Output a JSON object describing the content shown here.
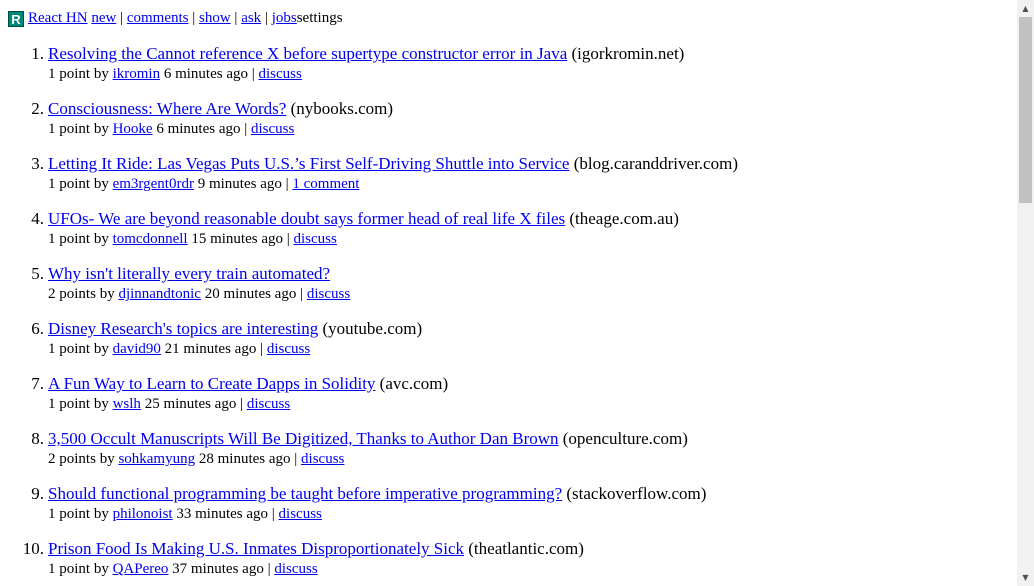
{
  "header": {
    "logo_letter": "R",
    "brand": "React HN",
    "nav": [
      {
        "label": "new"
      },
      {
        "label": "comments"
      },
      {
        "label": "show"
      },
      {
        "label": "ask"
      },
      {
        "label": "jobs"
      }
    ],
    "separator": "|",
    "settings_label": "settings",
    "logo_color": "#00897b"
  },
  "stories": [
    {
      "rank": "1.",
      "title": "Resolving the Cannot reference X before supertype constructor error in Java",
      "site": "(igorkromin.net)",
      "points": "1 point",
      "by": "by",
      "user": "ikromin",
      "age": "6 minutes ago",
      "discuss": "discuss"
    },
    {
      "rank": "2.",
      "title": "Consciousness: Where Are Words?",
      "site": "(nybooks.com)",
      "points": "1 point",
      "by": "by",
      "user": "Hooke",
      "age": "6 minutes ago",
      "discuss": "discuss"
    },
    {
      "rank": "3.",
      "title": "Letting It Ride: Las Vegas Puts U.S.’s First Self-Driving Shuttle into Service",
      "site": "(blog.caranddriver.com)",
      "points": "1 point",
      "by": "by",
      "user": "em3rgent0rdr",
      "age": "9 minutes ago",
      "discuss": "1 comment"
    },
    {
      "rank": "4.",
      "title": "UFOs- We are beyond reasonable doubt says former head of real life X files",
      "site": "(theage.com.au)",
      "points": "1 point",
      "by": "by",
      "user": "tomcdonnell",
      "age": "15 minutes ago",
      "discuss": "discuss"
    },
    {
      "rank": "5.",
      "title": "Why isn't literally every train automated?",
      "site": "",
      "points": "2 points",
      "by": "by",
      "user": "djinnandtonic",
      "age": "20 minutes ago",
      "discuss": "discuss"
    },
    {
      "rank": "6.",
      "title": "Disney Research's topics are interesting",
      "site": "(youtube.com)",
      "points": "1 point",
      "by": "by",
      "user": "david90",
      "age": "21 minutes ago",
      "discuss": "discuss"
    },
    {
      "rank": "7.",
      "title": "A Fun Way to Learn to Create Dapps in Solidity",
      "site": "(avc.com)",
      "points": "1 point",
      "by": "by",
      "user": "wslh",
      "age": "25 minutes ago",
      "discuss": "discuss"
    },
    {
      "rank": "8.",
      "title": "3,500 Occult Manuscripts Will Be Digitized, Thanks to Author Dan Brown",
      "site": "(openculture.com)",
      "points": "2 points",
      "by": "by",
      "user": "sohkamyung",
      "age": "28 minutes ago",
      "discuss": "discuss"
    },
    {
      "rank": "9.",
      "title": "Should functional programming be taught before imperative programming?",
      "site": "(stackoverflow.com)",
      "points": "1 point",
      "by": "by",
      "user": "philonoist",
      "age": "33 minutes ago",
      "discuss": "discuss"
    },
    {
      "rank": "10.",
      "title": "Prison Food Is Making U.S. Inmates Disproportionately Sick",
      "site": "(theatlantic.com)",
      "points": "1 point",
      "by": "by",
      "user": "QAPereo",
      "age": "37 minutes ago",
      "discuss": "discuss"
    }
  ],
  "scrollbar": {
    "up_icon": "triangle-up-icon",
    "down_icon": "triangle-down-icon"
  }
}
